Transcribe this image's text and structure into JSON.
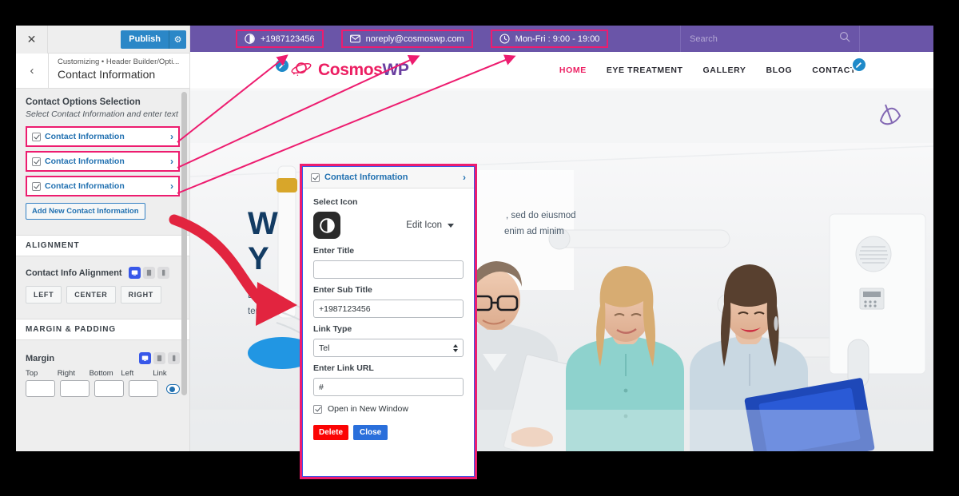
{
  "customizer": {
    "close_icon": "close-icon",
    "publish_label": "Publish",
    "gear_icon": "gear-icon",
    "back_icon": "chevron-left-icon",
    "breadcrumb": "Customizing • Header Builder/Opti...",
    "panel_title": "Contact Information",
    "section": {
      "heading": "Contact Options Selection",
      "description": "Select Contact Information and enter text",
      "items": [
        {
          "label": "Contact Information",
          "arrow": "›",
          "highlighted": true
        },
        {
          "label": "Contact Information",
          "arrow": "›",
          "highlighted": true
        },
        {
          "label": "Contact Information",
          "arrow": "›",
          "highlighted": true
        }
      ],
      "add_button": "Add New Contact Information"
    },
    "alignment": {
      "section_title": "ALIGNMENT",
      "field_label": "Contact Info Alignment",
      "devices": [
        "desktop-icon",
        "tablet-icon",
        "mobile-icon"
      ],
      "active_device": "desktop-icon",
      "options": [
        "LEFT",
        "CENTER",
        "RIGHT"
      ]
    },
    "margin_padding": {
      "section_title": "MARGIN & PADDING",
      "field_label": "Margin",
      "devices": [
        "desktop-icon",
        "tablet-icon",
        "mobile-icon"
      ],
      "active_device": "desktop-icon",
      "inputs": [
        {
          "label": "Top",
          "value": ""
        },
        {
          "label": "Right",
          "value": ""
        },
        {
          "label": "Bottom",
          "value": ""
        },
        {
          "label": "Left",
          "value": ""
        }
      ],
      "link_label": "Link"
    }
  },
  "preview": {
    "topbar": {
      "background": "#6a55a8",
      "items": [
        {
          "icon": "contrast-circle-icon",
          "text": "+1987123456",
          "highlighted": true
        },
        {
          "icon": "envelope-icon",
          "text": "noreply@cosmoswp.com",
          "highlighted": true
        },
        {
          "icon": "clock-icon",
          "text": "Mon-Fri : 9:00 - 19:00",
          "highlighted": true
        }
      ],
      "search_placeholder": "Search",
      "search_value": "",
      "search_icon": "search-icon"
    },
    "navbar": {
      "logo_icon": "saturn-planet-icon",
      "logo_primary": "Cosmos",
      "logo_secondary": "WP",
      "logo_primary_color": "#ec1e62",
      "logo_secondary_color": "#6a3fa0",
      "menu": [
        {
          "label": "HOME",
          "active": true
        },
        {
          "label": "EYE TREATMENT",
          "active": false
        },
        {
          "label": "GALLERY",
          "active": false
        },
        {
          "label": "BLOG",
          "active": false
        },
        {
          "label": "CONTACT",
          "active": false
        }
      ],
      "edit_icon": "pencil-edit-icon"
    },
    "hero": {
      "heading_line1": "W",
      "heading_line2": "Y",
      "paragraph_line1": "Lore",
      "paragraph_line2": "tem",
      "paragraph_right1": ", sed do eiusmod",
      "paragraph_right2": " enim ad minim"
    }
  },
  "modal": {
    "header": {
      "label": "Contact Information",
      "arrow": "›",
      "checked": true
    },
    "select_icon_label": "Select Icon",
    "icon_preview": "contrast-circle-icon",
    "edit_icon_label": "Edit Icon",
    "fields": [
      {
        "label": "Enter Title",
        "value": "",
        "name": "title-field"
      },
      {
        "label": "Enter Sub Title",
        "value": "+1987123456",
        "name": "subtitle-field"
      }
    ],
    "link_type": {
      "label": "Link Type",
      "value": "Tel"
    },
    "link_url": {
      "label": "Enter Link URL",
      "value": "#"
    },
    "new_window": {
      "label": "Open in New Window",
      "checked": true
    },
    "delete_label": "Delete",
    "close_label": "Close"
  },
  "colors": {
    "accent_pink": "#ed1c6f",
    "purple_bar": "#6a55a8",
    "publish_blue": "#2b87c7",
    "link_blue": "#2271b1",
    "delete_red": "#fb0404",
    "close_blue": "#2a6fdb"
  }
}
